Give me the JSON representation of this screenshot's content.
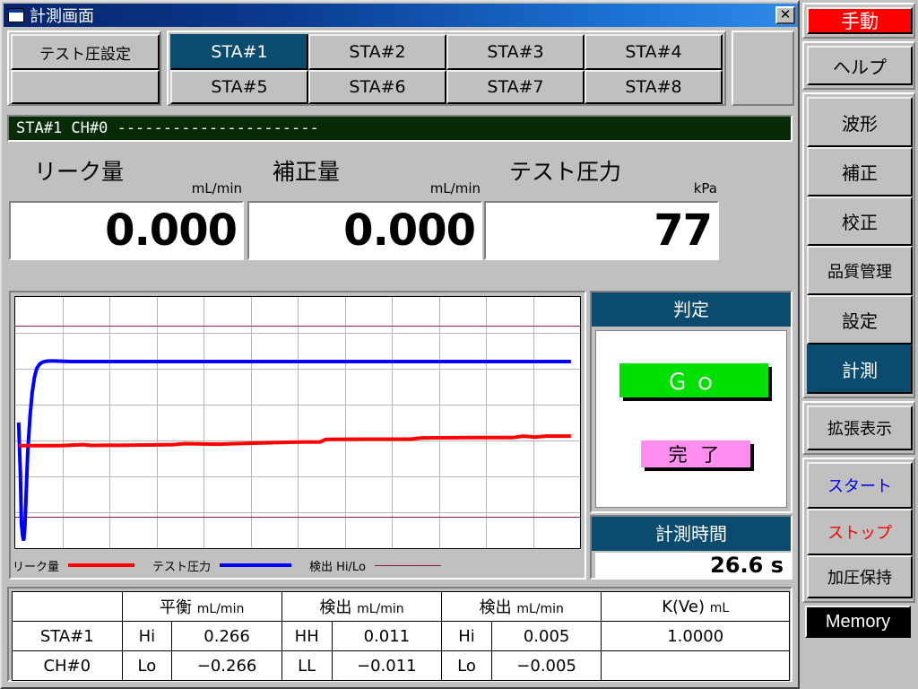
{
  "window": {
    "title": "計測画面",
    "close_label": "✕"
  },
  "tabs": {
    "test_pressure_label": "テスト圧設定",
    "blank_label": "",
    "stations": [
      "STA#1",
      "STA#2",
      "STA#3",
      "STA#4",
      "STA#5",
      "STA#6",
      "STA#7",
      "STA#8"
    ],
    "selected": "STA#1"
  },
  "status": {
    "text": "STA#1  CH#0  ----------------------"
  },
  "readouts": [
    {
      "name": "リーク量",
      "unit": "mL/min",
      "value": "0.000"
    },
    {
      "name": "補正量",
      "unit": "mL/min",
      "value": "0.000"
    },
    {
      "name": "テスト圧力",
      "unit": "kPa",
      "value": "77"
    }
  ],
  "legend": [
    {
      "label": "リーク量",
      "color": "#ff0000",
      "width": 4
    },
    {
      "label": "テスト圧力",
      "color": "#0000ff",
      "width": 4
    },
    {
      "label": "検出 Hi/Lo",
      "color": "#8b1a45",
      "width": 1
    }
  ],
  "judgment": {
    "header": "判定",
    "result": "Ｇｏ",
    "result_color": "#00e000",
    "status": "完 了",
    "status_color": "#ff8ef0"
  },
  "time": {
    "header": "計測時間",
    "value": "26.6 s"
  },
  "table": {
    "headers": [
      {
        "main": "",
        "unit": ""
      },
      {
        "main": "平衡",
        "unit": "mL/min"
      },
      {
        "main": "検出",
        "unit": "mL/min"
      },
      {
        "main": "検出",
        "unit": "mL/min"
      },
      {
        "main": "K(Ve)",
        "unit": "mL"
      }
    ],
    "rows": [
      {
        "label": "STA#1",
        "c1_key": "Hi",
        "c1_val": "0.266",
        "c2_key": "HH",
        "c2_val": "0.011",
        "c3_key": "Hi",
        "c3_val": "0.005",
        "c4_val": "1.0000"
      },
      {
        "label": "CH#0",
        "c1_key": "Lo",
        "c1_val": "−0.266",
        "c2_key": "LL",
        "c2_val": "−0.011",
        "c3_key": "Lo",
        "c3_val": "−0.005",
        "c4_val": ""
      }
    ]
  },
  "sidebar": {
    "mode": "手動",
    "help": "ヘルプ",
    "group_main": [
      "波形",
      "補正",
      "校正",
      "品質管理",
      "設定",
      "計測"
    ],
    "selected_main": "計測",
    "expand": "拡張表示",
    "start": "スタート",
    "stop": "ストップ",
    "hold": "加圧保持",
    "memory": "Memory"
  },
  "chart_data": {
    "type": "line",
    "title": "",
    "xlabel": "",
    "ylabel": "",
    "xlim": [
      0,
      100
    ],
    "ylim": [
      0,
      100
    ],
    "grid": true,
    "grid_cols": 12,
    "grid_rows": 7,
    "legend_position": "bottom",
    "series": [
      {
        "name": "テスト圧力",
        "color": "#0000ff",
        "width": 4,
        "points": [
          [
            0.6,
            50
          ],
          [
            0.9,
            30
          ],
          [
            1.1,
            10
          ],
          [
            1.3,
            5
          ],
          [
            1.5,
            3
          ],
          [
            1.7,
            8
          ],
          [
            1.9,
            20
          ],
          [
            2.2,
            38
          ],
          [
            2.6,
            52
          ],
          [
            3.0,
            62
          ],
          [
            3.4,
            68
          ],
          [
            3.8,
            71.5
          ],
          [
            4.3,
            73.2
          ],
          [
            4.8,
            74.0
          ],
          [
            5.4,
            74.4
          ],
          [
            6.0,
            74.5
          ],
          [
            7.0,
            74.5
          ],
          [
            10,
            74.3
          ],
          [
            20,
            74.3
          ],
          [
            30,
            74.3
          ],
          [
            40,
            74.3
          ],
          [
            50,
            74.3
          ],
          [
            60,
            74.3
          ],
          [
            70,
            74.3
          ],
          [
            80,
            74.3
          ],
          [
            90,
            74.3
          ],
          [
            98.4,
            74.3
          ]
        ]
      },
      {
        "name": "リーク量",
        "color": "#ff0000",
        "width": 4,
        "points": [
          [
            0.6,
            40.8
          ],
          [
            3,
            40.8
          ],
          [
            8,
            40.8
          ],
          [
            12,
            41.2
          ],
          [
            13.5,
            40.9
          ],
          [
            20,
            41.0
          ],
          [
            28,
            41.2
          ],
          [
            30,
            41.6
          ],
          [
            36,
            41.4
          ],
          [
            42,
            41.8
          ],
          [
            50,
            42.2
          ],
          [
            54,
            42.3
          ],
          [
            55,
            43.3
          ],
          [
            62,
            43.4
          ],
          [
            70,
            43.4
          ],
          [
            72,
            43.9
          ],
          [
            80,
            44.0
          ],
          [
            88,
            44.0
          ],
          [
            90,
            44.6
          ],
          [
            92,
            44.2
          ],
          [
            94,
            44.6
          ],
          [
            96,
            44.6
          ],
          [
            98.4,
            44.6
          ]
        ]
      }
    ],
    "threshold_lines": [
      {
        "name": "検出 Hi",
        "value": 88.5,
        "color": "#8b1a45",
        "width": 1
      },
      {
        "name": "検出 Lo",
        "value": 12.5,
        "color": "#8b1a45",
        "width": 1
      }
    ]
  }
}
